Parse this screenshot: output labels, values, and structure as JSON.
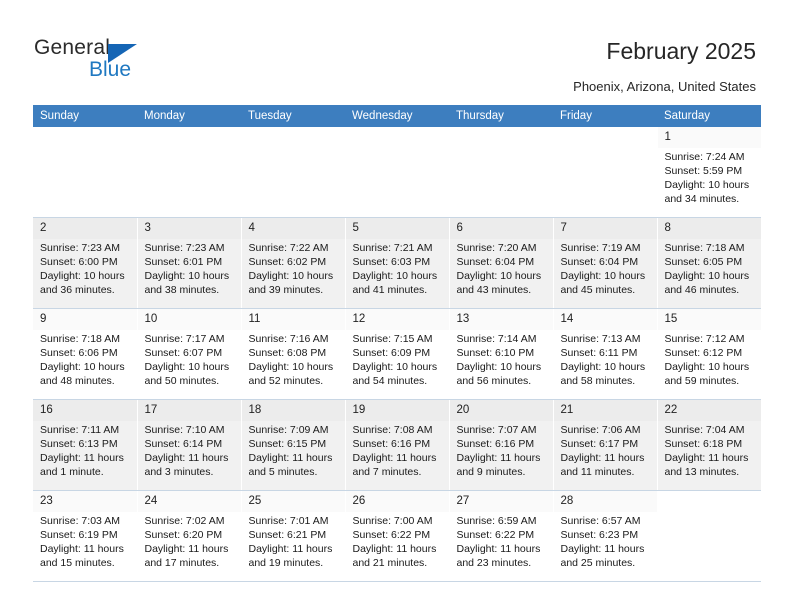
{
  "brand": {
    "name_top": "General",
    "name_bottom": "Blue",
    "accent_color": "#1f78c1",
    "triangle_color": "#1565b5"
  },
  "header": {
    "title": "February 2025",
    "subtitle": "Phoenix, Arizona, United States",
    "header_bg": "#3d7ebf",
    "header_text_color": "#ffffff"
  },
  "calendar": {
    "weekday_headers": [
      "Sunday",
      "Monday",
      "Tuesday",
      "Wednesday",
      "Thursday",
      "Friday",
      "Saturday"
    ],
    "labels": {
      "sunrise": "Sunrise:",
      "sunset": "Sunset:",
      "daylight": "Daylight:"
    },
    "weeks": [
      {
        "shaded": false,
        "days": [
          {
            "empty": true
          },
          {
            "empty": true
          },
          {
            "empty": true
          },
          {
            "empty": true
          },
          {
            "empty": true
          },
          {
            "empty": true
          },
          {
            "empty": false,
            "date": "1",
            "sunrise": "Sunrise: 7:24 AM",
            "sunset": "Sunset: 5:59 PM",
            "daylight": "Daylight: 10 hours and 34 minutes."
          }
        ]
      },
      {
        "shaded": true,
        "days": [
          {
            "empty": false,
            "date": "2",
            "sunrise": "Sunrise: 7:23 AM",
            "sunset": "Sunset: 6:00 PM",
            "daylight": "Daylight: 10 hours and 36 minutes."
          },
          {
            "empty": false,
            "date": "3",
            "sunrise": "Sunrise: 7:23 AM",
            "sunset": "Sunset: 6:01 PM",
            "daylight": "Daylight: 10 hours and 38 minutes."
          },
          {
            "empty": false,
            "date": "4",
            "sunrise": "Sunrise: 7:22 AM",
            "sunset": "Sunset: 6:02 PM",
            "daylight": "Daylight: 10 hours and 39 minutes."
          },
          {
            "empty": false,
            "date": "5",
            "sunrise": "Sunrise: 7:21 AM",
            "sunset": "Sunset: 6:03 PM",
            "daylight": "Daylight: 10 hours and 41 minutes."
          },
          {
            "empty": false,
            "date": "6",
            "sunrise": "Sunrise: 7:20 AM",
            "sunset": "Sunset: 6:04 PM",
            "daylight": "Daylight: 10 hours and 43 minutes."
          },
          {
            "empty": false,
            "date": "7",
            "sunrise": "Sunrise: 7:19 AM",
            "sunset": "Sunset: 6:04 PM",
            "daylight": "Daylight: 10 hours and 45 minutes."
          },
          {
            "empty": false,
            "date": "8",
            "sunrise": "Sunrise: 7:18 AM",
            "sunset": "Sunset: 6:05 PM",
            "daylight": "Daylight: 10 hours and 46 minutes."
          }
        ]
      },
      {
        "shaded": false,
        "days": [
          {
            "empty": false,
            "date": "9",
            "sunrise": "Sunrise: 7:18 AM",
            "sunset": "Sunset: 6:06 PM",
            "daylight": "Daylight: 10 hours and 48 minutes."
          },
          {
            "empty": false,
            "date": "10",
            "sunrise": "Sunrise: 7:17 AM",
            "sunset": "Sunset: 6:07 PM",
            "daylight": "Daylight: 10 hours and 50 minutes."
          },
          {
            "empty": false,
            "date": "11",
            "sunrise": "Sunrise: 7:16 AM",
            "sunset": "Sunset: 6:08 PM",
            "daylight": "Daylight: 10 hours and 52 minutes."
          },
          {
            "empty": false,
            "date": "12",
            "sunrise": "Sunrise: 7:15 AM",
            "sunset": "Sunset: 6:09 PM",
            "daylight": "Daylight: 10 hours and 54 minutes."
          },
          {
            "empty": false,
            "date": "13",
            "sunrise": "Sunrise: 7:14 AM",
            "sunset": "Sunset: 6:10 PM",
            "daylight": "Daylight: 10 hours and 56 minutes."
          },
          {
            "empty": false,
            "date": "14",
            "sunrise": "Sunrise: 7:13 AM",
            "sunset": "Sunset: 6:11 PM",
            "daylight": "Daylight: 10 hours and 58 minutes."
          },
          {
            "empty": false,
            "date": "15",
            "sunrise": "Sunrise: 7:12 AM",
            "sunset": "Sunset: 6:12 PM",
            "daylight": "Daylight: 10 hours and 59 minutes."
          }
        ]
      },
      {
        "shaded": true,
        "days": [
          {
            "empty": false,
            "date": "16",
            "sunrise": "Sunrise: 7:11 AM",
            "sunset": "Sunset: 6:13 PM",
            "daylight": "Daylight: 11 hours and 1 minute."
          },
          {
            "empty": false,
            "date": "17",
            "sunrise": "Sunrise: 7:10 AM",
            "sunset": "Sunset: 6:14 PM",
            "daylight": "Daylight: 11 hours and 3 minutes."
          },
          {
            "empty": false,
            "date": "18",
            "sunrise": "Sunrise: 7:09 AM",
            "sunset": "Sunset: 6:15 PM",
            "daylight": "Daylight: 11 hours and 5 minutes."
          },
          {
            "empty": false,
            "date": "19",
            "sunrise": "Sunrise: 7:08 AM",
            "sunset": "Sunset: 6:16 PM",
            "daylight": "Daylight: 11 hours and 7 minutes."
          },
          {
            "empty": false,
            "date": "20",
            "sunrise": "Sunrise: 7:07 AM",
            "sunset": "Sunset: 6:16 PM",
            "daylight": "Daylight: 11 hours and 9 minutes."
          },
          {
            "empty": false,
            "date": "21",
            "sunrise": "Sunrise: 7:06 AM",
            "sunset": "Sunset: 6:17 PM",
            "daylight": "Daylight: 11 hours and 11 minutes."
          },
          {
            "empty": false,
            "date": "22",
            "sunrise": "Sunrise: 7:04 AM",
            "sunset": "Sunset: 6:18 PM",
            "daylight": "Daylight: 11 hours and 13 minutes."
          }
        ]
      },
      {
        "shaded": false,
        "days": [
          {
            "empty": false,
            "date": "23",
            "sunrise": "Sunrise: 7:03 AM",
            "sunset": "Sunset: 6:19 PM",
            "daylight": "Daylight: 11 hours and 15 minutes."
          },
          {
            "empty": false,
            "date": "24",
            "sunrise": "Sunrise: 7:02 AM",
            "sunset": "Sunset: 6:20 PM",
            "daylight": "Daylight: 11 hours and 17 minutes."
          },
          {
            "empty": false,
            "date": "25",
            "sunrise": "Sunrise: 7:01 AM",
            "sunset": "Sunset: 6:21 PM",
            "daylight": "Daylight: 11 hours and 19 minutes."
          },
          {
            "empty": false,
            "date": "26",
            "sunrise": "Sunrise: 7:00 AM",
            "sunset": "Sunset: 6:22 PM",
            "daylight": "Daylight: 11 hours and 21 minutes."
          },
          {
            "empty": false,
            "date": "27",
            "sunrise": "Sunrise: 6:59 AM",
            "sunset": "Sunset: 6:22 PM",
            "daylight": "Daylight: 11 hours and 23 minutes."
          },
          {
            "empty": false,
            "date": "28",
            "sunrise": "Sunrise: 6:57 AM",
            "sunset": "Sunset: 6:23 PM",
            "daylight": "Daylight: 11 hours and 25 minutes."
          },
          {
            "empty": true
          }
        ]
      }
    ]
  }
}
